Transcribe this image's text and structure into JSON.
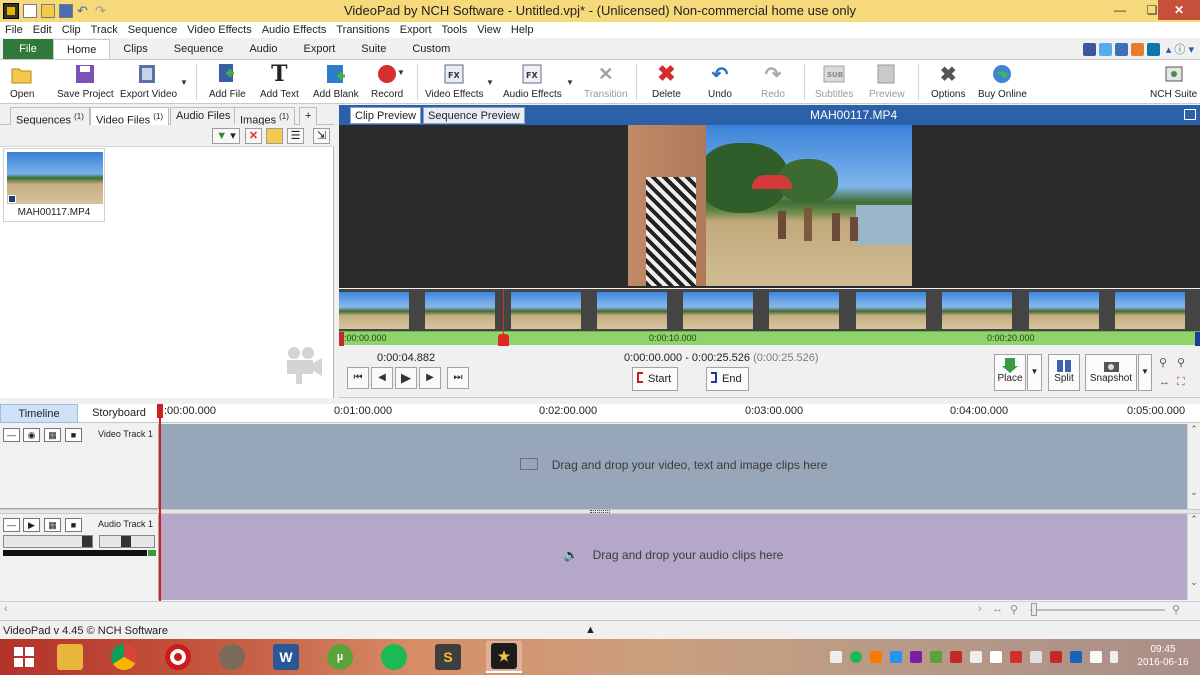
{
  "window": {
    "title": "VideoPad by NCH Software - Untitled.vpj* - (Unlicensed) Non-commercial home use only",
    "min": "—",
    "max": "❏",
    "close": "✕"
  },
  "menu": [
    "File",
    "Edit",
    "Clip",
    "Track",
    "Sequence",
    "Video Effects",
    "Audio Effects",
    "Transitions",
    "Export",
    "Tools",
    "View",
    "Help"
  ],
  "ribbon_tabs": {
    "file": "File",
    "tabs": [
      "Home",
      "Clips",
      "Sequence",
      "Audio",
      "Export",
      "Suite",
      "Custom"
    ],
    "active": "Home",
    "help": "▴ ⓘ ▾"
  },
  "ribbon": {
    "open": "Open",
    "save_project": "Save Project",
    "export_video": "Export Video",
    "add_file": "Add File",
    "add_text": "Add Text",
    "add_blank": "Add Blank",
    "record": "Record",
    "video_effects": "Video Effects",
    "audio_effects": "Audio Effects",
    "transition": "Transition",
    "delete": "Delete",
    "undo": "Undo",
    "redo": "Redo",
    "subtitles": "Subtitles",
    "preview": "Preview",
    "options": "Options",
    "buy_online": "Buy Online",
    "nch_suite": "NCH Suite"
  },
  "bin_tabs": [
    {
      "label": "Sequences",
      "count": "(1)"
    },
    {
      "label": "Video Files",
      "count": "(1)"
    },
    {
      "label": "Audio Files",
      "count": ""
    },
    {
      "label": "Images",
      "count": "(1)"
    },
    {
      "label": "+",
      "count": ""
    }
  ],
  "bin_active": "Video Files",
  "bin_files": [
    {
      "name": "MAH00117.MP4"
    }
  ],
  "preview": {
    "tabs": [
      "Clip Preview",
      "Sequence Preview"
    ],
    "active_tab": "Clip Preview",
    "clip_name": "MAH00117.MP4",
    "scrub_labels": [
      ":00:00.000",
      "0:00:10.000",
      "0:00:20.000"
    ],
    "current_time": "0:00:04.882",
    "range_start": "0:00:00.000",
    "range_dash": "-",
    "range_end": "0:00:25.526",
    "range_duration": "(0:00:25.526)",
    "start_label": "Start",
    "end_label": "End",
    "place_label": "Place",
    "split_label": "Split",
    "snapshot_label": "Snapshot"
  },
  "timeline": {
    "tabs": [
      "Timeline",
      "Storyboard"
    ],
    "active_tab": "Timeline",
    "ruler": [
      ":00:00.000",
      "0:01:00.000",
      "0:02:00.000",
      "0:03:00.000",
      "0:04:00.000",
      "0:05:00.000"
    ],
    "video_track": "Video Track 1",
    "audio_track": "Audio Track 1",
    "video_hint": "Drag and drop your video, text and image clips here",
    "audio_hint": "Drag and drop your audio clips here"
  },
  "status": {
    "text": "VideoPad v 4.45 © NCH Software",
    "up_arrow": "▲"
  },
  "taskbar": {
    "time": "09:45",
    "date": "2016-06-16"
  },
  "colors": {
    "titlebar": "#f5d97a",
    "file_tab": "#2f7a3a",
    "preview_header": "#2b61a8",
    "video_track": "#97a6b8",
    "audio_track": "#b4a7c7",
    "scrub_bar": "#8fd46a",
    "playhead": "#d41e1e"
  }
}
